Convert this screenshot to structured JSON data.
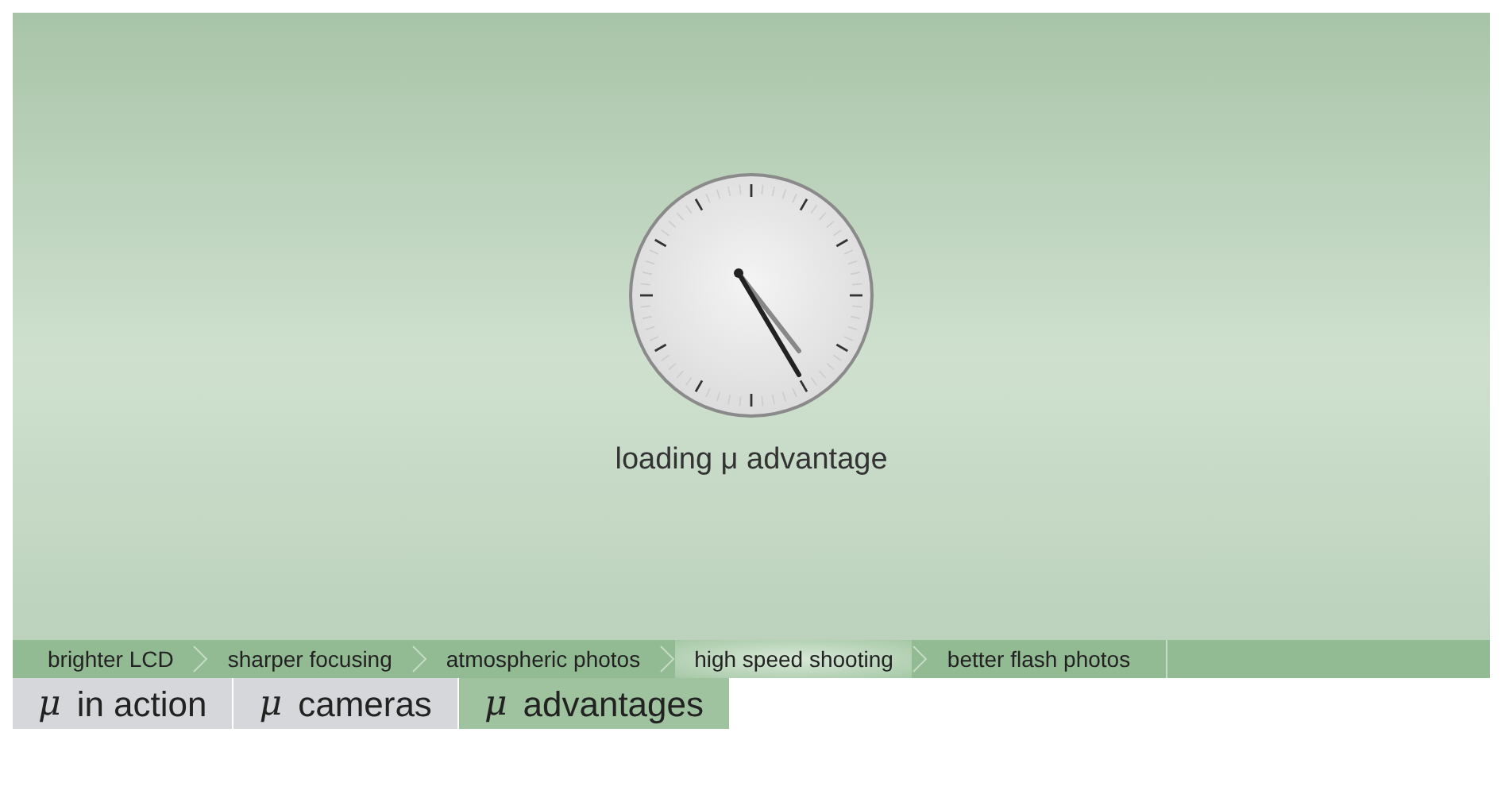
{
  "loader": {
    "caption": "loading μ advantage"
  },
  "breadcrumbs": [
    {
      "label": "brighter LCD",
      "selected": false
    },
    {
      "label": "sharper focusing",
      "selected": false
    },
    {
      "label": "atmospheric photos",
      "selected": false
    },
    {
      "label": "high speed shooting",
      "selected": true
    },
    {
      "label": "better flash photos",
      "selected": false
    }
  ],
  "tabs": [
    {
      "symbol": "μ",
      "label": "in action",
      "selected": false
    },
    {
      "symbol": "μ",
      "label": "cameras",
      "selected": false
    },
    {
      "symbol": "μ",
      "label": "advantages",
      "selected": true
    }
  ]
}
